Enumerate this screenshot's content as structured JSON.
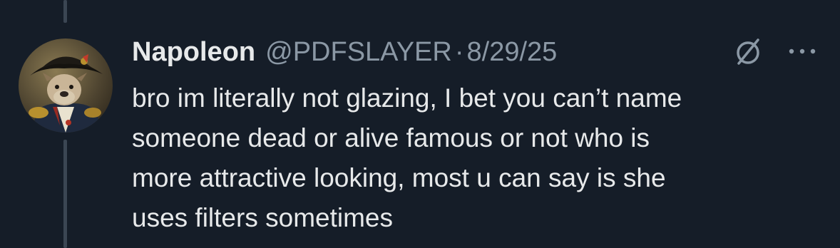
{
  "tweet": {
    "author_name": "Napoleon",
    "handle": "@PDFSLAYER",
    "separator": "·",
    "date": "8/29/25",
    "text": "bro im literally not glazing, I bet you can’t name\nsomeone dead or alive famous or not who is\nmore attractive looking, most u can say is she\nuses filters sometimes"
  },
  "icons": {
    "avatar": "avatar-dog-in-napoleon-bicorne-hat",
    "grok": "grok-slash-circle-icon",
    "more": "more-horizontal-icon"
  },
  "colors": {
    "background": "#151d28",
    "primary_text": "#e7e9ea",
    "secondary_text": "#8b98a5",
    "thread_line": "#3b4653"
  }
}
